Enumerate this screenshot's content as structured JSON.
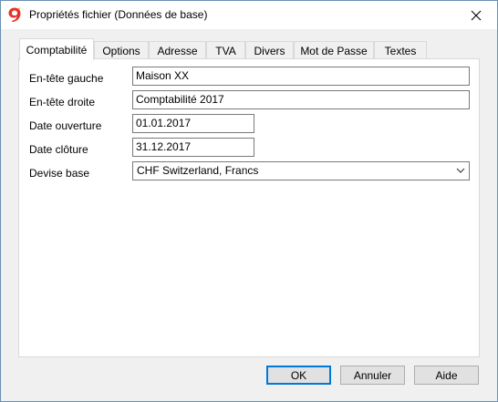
{
  "window": {
    "title": "Propriétés fichier (Données de base)",
    "icon": "banana-9-app-icon",
    "accent_color": "#e6332a"
  },
  "tabs": [
    {
      "label": "Comptabilité",
      "active": true
    },
    {
      "label": "Options",
      "active": false
    },
    {
      "label": "Adresse",
      "active": false
    },
    {
      "label": "TVA",
      "active": false
    },
    {
      "label": "Divers",
      "active": false
    },
    {
      "label": "Mot de Passe",
      "active": false
    },
    {
      "label": "Textes",
      "active": false
    }
  ],
  "form": {
    "header_left": {
      "label": "En-tête gauche",
      "value": "Maison XX"
    },
    "header_right": {
      "label": "En-tête droite",
      "value": "Comptabilité 2017"
    },
    "opening_date": {
      "label": "Date ouverture",
      "value": "01.01.2017"
    },
    "closing_date": {
      "label": "Date clôture",
      "value": "31.12.2017"
    },
    "base_currency": {
      "label": "Devise base",
      "value": "CHF Switzerland, Francs"
    }
  },
  "buttons": {
    "ok": "OK",
    "cancel": "Annuler",
    "help": "Aide"
  }
}
